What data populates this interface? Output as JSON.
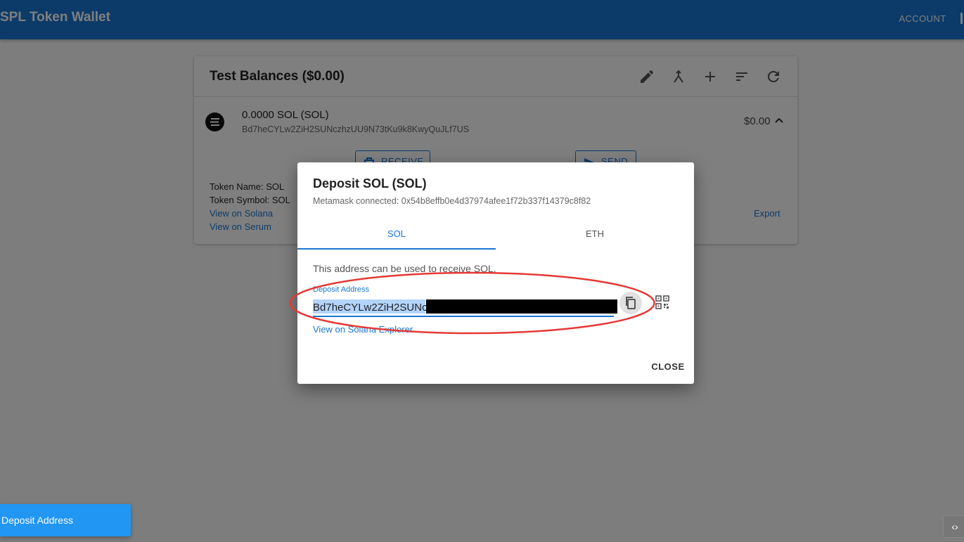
{
  "appbar": {
    "title": "SPL Token Wallet",
    "account_label": "ACCOUNT"
  },
  "balances": {
    "title": "Test Balances ($0.00)",
    "toolbar_icons": [
      "edit-icon",
      "merge-icon",
      "add-icon",
      "sort-icon",
      "refresh-icon"
    ],
    "token": {
      "balance": "0.0000 SOL (SOL)",
      "address": "Bd7heCYLw2ZiH2SUNczhzUU9N73tKu9k8KwyQuJLf7US",
      "usd_value": "$0.00",
      "receive_label": "RECEIVE",
      "send_label": "SEND",
      "token_name": "Token Name: SOL",
      "token_symbol": "Token Symbol: SOL",
      "view_solana": "View on Solana",
      "view_serum": "View on Serum",
      "export_label": "Export"
    }
  },
  "dialog": {
    "title": "Deposit SOL (SOL)",
    "subtitle": "Metamask connected: 0x54b8effb0e4d37974afee1f72b337f14379c8f82",
    "tabs": [
      {
        "label": "SOL",
        "active": true
      },
      {
        "label": "ETH",
        "active": false
      }
    ],
    "info_text": "This address can be used to receive SOL.",
    "field_label": "Deposit Address",
    "field_value": "Bd7heCYLw2ZiH2SUNc",
    "explorer_link": "View on Solana Explorer",
    "close_label": "CLOSE"
  },
  "toast": {
    "text": "Deposit Address"
  },
  "corner_button": {
    "label": "‹›"
  },
  "colors": {
    "primary": "#1976d2",
    "toast": "#2196f3",
    "annotation": "#e53935",
    "redaction": "#000000"
  }
}
